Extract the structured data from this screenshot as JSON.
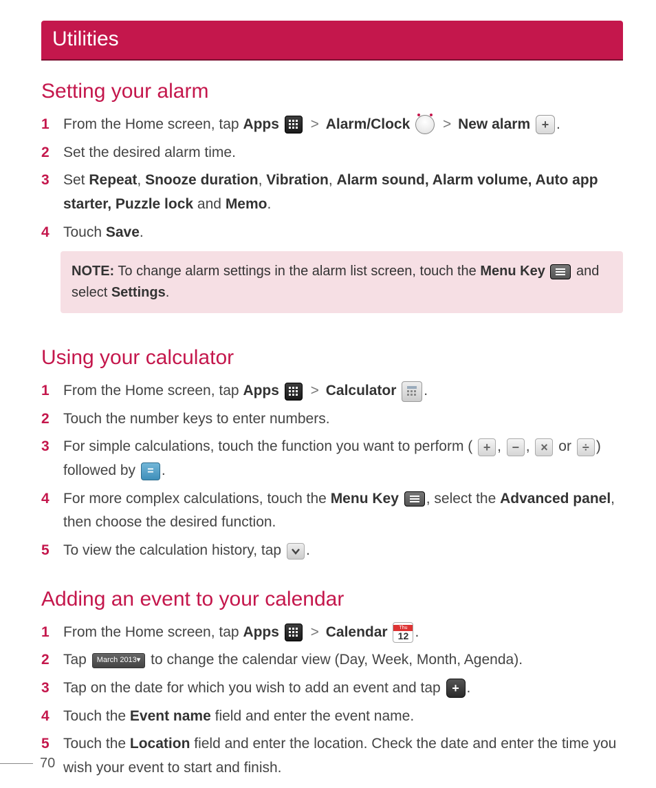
{
  "chapter": "Utilities",
  "page_number": "70",
  "sections": {
    "alarm": {
      "heading": "Setting your alarm",
      "step1_a": "From the Home screen, tap ",
      "step1_apps": "Apps",
      "step1_sep1": " > ",
      "step1_alarmclock": "Alarm/Clock",
      "step1_sep2": " > ",
      "step1_newalarm": "New alarm",
      "step1_end": ".",
      "step2": "Set the desired alarm time.",
      "step3_a": "Set ",
      "step3_repeat": "Repeat",
      "step3_c1": ", ",
      "step3_snooze": "Snooze duration",
      "step3_c2": ", ",
      "step3_vibration": "Vibration",
      "step3_c3": ", ",
      "step3_rest_bold": "Alarm sound, Alarm volume, Auto app starter, Puzzle lock",
      "step3_and": " and ",
      "step3_memo": "Memo",
      "step3_end": ".",
      "step4_a": "Touch ",
      "step4_save": "Save",
      "step4_end": ".",
      "note_pre": "NOTE:",
      "note_text_a": " To change alarm settings in the alarm list screen, touch the ",
      "note_menukey": "Menu Key",
      "note_text_b": " and select ",
      "note_settings": "Settings",
      "note_end": "."
    },
    "calc": {
      "heading": "Using your calculator",
      "step1_a": "From the Home screen, tap ",
      "step1_apps": "Apps",
      "step1_sep": " > ",
      "step1_calc": "Calculator",
      "step1_end": ".",
      "step2": "Touch the number keys to enter numbers.",
      "step3_a": "For simple calculations, touch the function you want to perform (",
      "step3_comma": ", ",
      "step3_or": " or ",
      "step3_paren": ") followed by ",
      "step3_end": ".",
      "step4_a": "For more complex calculations, touch the ",
      "step4_menukey": "Menu Key",
      "step4_b": ", select the ",
      "step4_adv": "Advanced panel",
      "step4_c": ", then choose the desired function.",
      "step5_a": "To view the calculation history, tap ",
      "step5_end": "."
    },
    "cal": {
      "heading": "Adding an event to your calendar",
      "step1_a": "From the Home screen, tap ",
      "step1_apps": "Apps",
      "step1_sep": " > ",
      "step1_calendar": "Calendar",
      "step1_end": ".",
      "step2_a": "Tap ",
      "step2_drop_label": "March 2013",
      "step2_b": " to change the calendar view (Day, Week, Month, Agenda).",
      "step3_a": "Tap on the date for which you wish to add an event and tap ",
      "step3_end": ".",
      "step4_a": "Touch the ",
      "step4_eventname": "Event name",
      "step4_b": " field and enter the event name.",
      "step5_a": "Touch the ",
      "step5_location": "Location",
      "step5_b": " field and enter the location. Check the date and enter the time you wish your event to start and finish."
    }
  },
  "icons": {
    "cal_top": "Thu",
    "cal_day": "12"
  }
}
